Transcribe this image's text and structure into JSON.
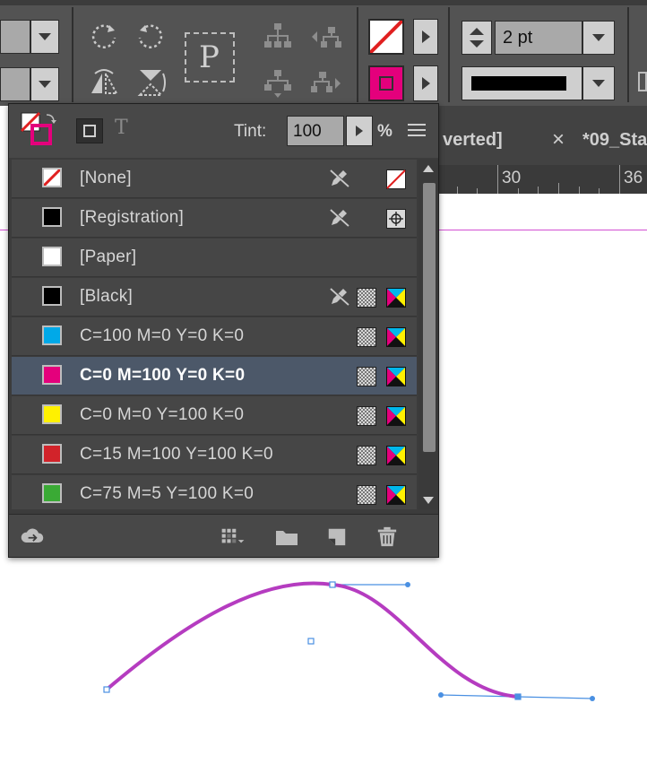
{
  "control_bar": {
    "stroke_weight": "2 pt",
    "reference_glyph": "P",
    "colors": {
      "fill_none_slash": "#e02020",
      "stroke_magenta": "#e4007c",
      "stroke_style": "#000000"
    }
  },
  "document_tabs": {
    "tab1_partial": "verted]",
    "tab2_partial": "*09_Sta",
    "close_glyph": "×"
  },
  "ruler": {
    "ticks": [
      "30",
      "36"
    ]
  },
  "swatches_panel": {
    "tint_label": "Tint:",
    "tint_value": "100",
    "tint_unit": "%",
    "text_toggle_glyph": "T",
    "swatches": [
      {
        "name": "[None]",
        "color": "none",
        "icons": [
          "pencil-no-edit-icon",
          "none-swatch-icon"
        ]
      },
      {
        "name": "[Registration]",
        "color": "#000000",
        "icons": [
          "pencil-no-edit-icon",
          "registration-target-icon"
        ]
      },
      {
        "name": "[Paper]",
        "color": "#ffffff",
        "icons": []
      },
      {
        "name": "[Black]",
        "color": "#000000",
        "icons": [
          "pencil-no-edit-icon",
          "process-grid-icon",
          "cmyk-mode-icon"
        ]
      },
      {
        "name": "C=100 M=0 Y=0 K=0",
        "color": "#00a9e8",
        "icons": [
          "process-grid-icon",
          "cmyk-mode-icon"
        ]
      },
      {
        "name": "C=0 M=100 Y=0 K=0",
        "color": "#e4007c",
        "icons": [
          "process-grid-icon",
          "cmyk-mode-icon"
        ],
        "selected": true
      },
      {
        "name": "C=0 M=0 Y=100 K=0",
        "color": "#fff100",
        "icons": [
          "process-grid-icon",
          "cmyk-mode-icon"
        ]
      },
      {
        "name": "C=15 M=100 Y=100 K=0",
        "color": "#d2232a",
        "icons": [
          "process-grid-icon",
          "cmyk-mode-icon"
        ]
      },
      {
        "name": "C=75 M=5 Y=100 K=0",
        "color": "#3aaa35",
        "icons": [
          "process-grid-icon",
          "cmyk-mode-icon"
        ]
      }
    ]
  },
  "canvas": {
    "path_color": "#b53cc0",
    "handle_color": "#4a90e2",
    "page_edge_color": "#d24fd2"
  }
}
